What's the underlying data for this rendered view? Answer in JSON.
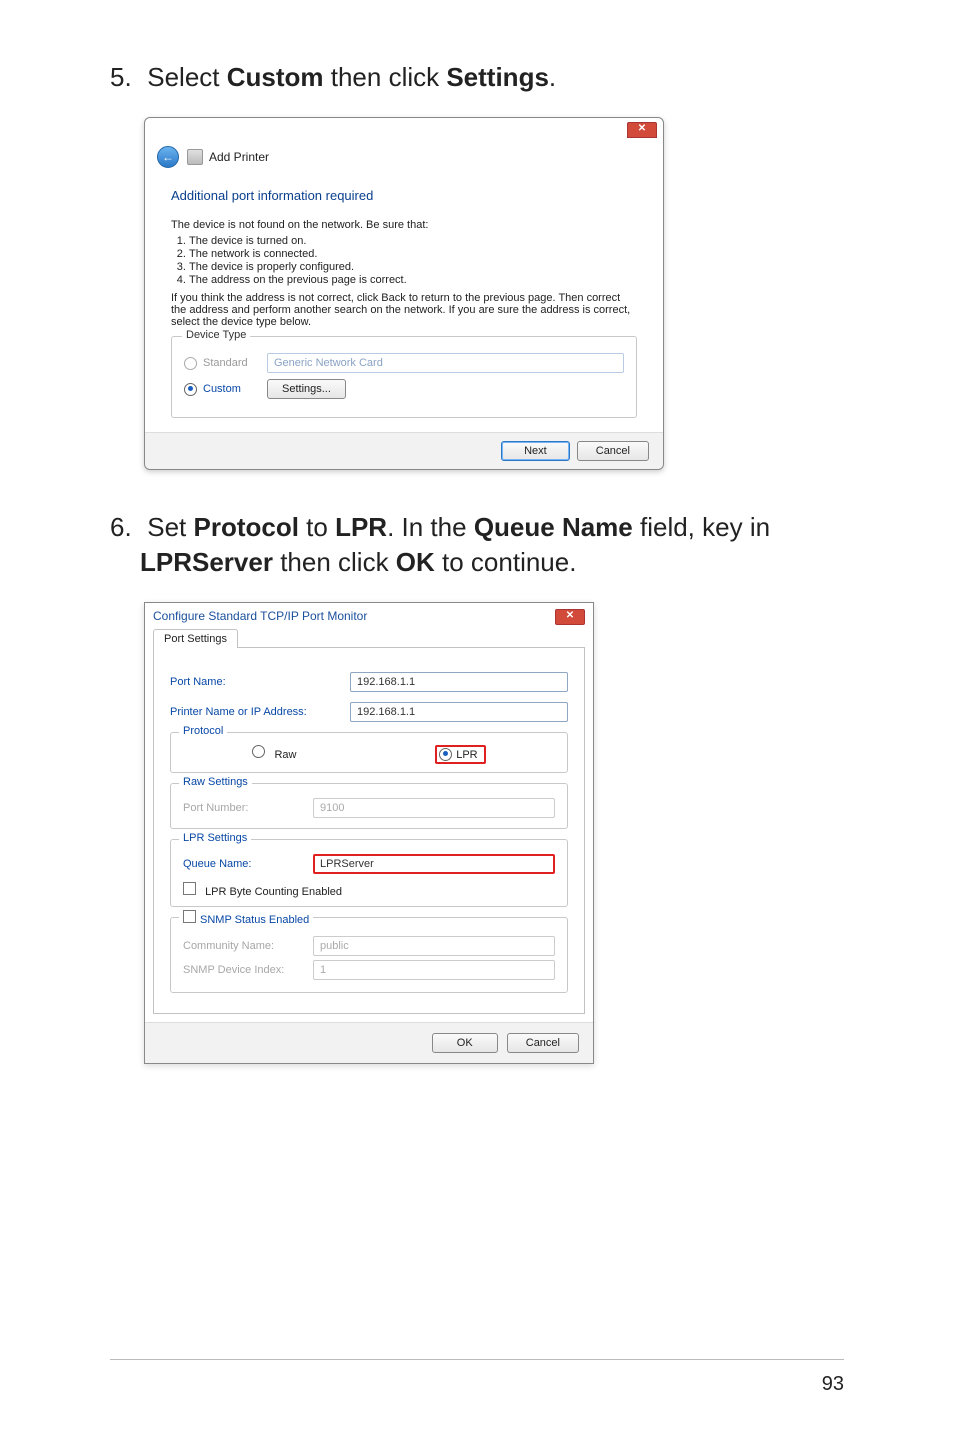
{
  "page_number": "93",
  "step5": {
    "number": "5.",
    "prefix": "Select ",
    "b1": "Custom",
    "mid": " then click ",
    "b2": "Settings",
    "suffix": "."
  },
  "step6": {
    "number": "6.",
    "prefix": "Set ",
    "b1": "Protocol",
    "mid1": " to ",
    "b2": "LPR",
    "mid2": ". In the ",
    "b3": "Queue Name",
    "mid3": " field, key in ",
    "b4": "LPRServer",
    "mid4": " then click ",
    "b5": "OK",
    "suffix": " to continue."
  },
  "dlg1": {
    "close": "✕",
    "back": "←",
    "title": "Add Printer",
    "subtitle": "Additional port information required",
    "intro": "The device is not found on the network.  Be sure that:",
    "items": [
      "The device is turned on.",
      "The network is connected.",
      "The device is properly configured.",
      "The address on the previous page is correct."
    ],
    "para": "If you think the address is not correct, click Back to return to the previous page.  Then correct the address and perform another search on the network.  If you are sure the address is correct, select the device type below.",
    "group_label": "Device Type",
    "standard_label": "Standard",
    "standard_value": "Generic Network Card",
    "custom_label": "Custom",
    "settings_btn": "Settings...",
    "next_btn": "Next",
    "cancel_btn": "Cancel"
  },
  "dlg2": {
    "title": "Configure Standard TCP/IP Port Monitor",
    "close": "✕",
    "tab": "Port Settings",
    "portname_label": "Port Name:",
    "portname_value": "192.168.1.1",
    "addr_label": "Printer Name or IP Address:",
    "addr_value": "192.168.1.1",
    "protocol_label": "Protocol",
    "raw_label": "Raw",
    "lpr_label": "LPR",
    "raw_settings_label": "Raw Settings",
    "portnum_label": "Port Number:",
    "portnum_value": "9100",
    "lpr_settings_label": "LPR Settings",
    "queue_label": "Queue Name:",
    "queue_value": "LPRServer",
    "lpr_byte_label": "LPR Byte Counting Enabled",
    "snmp_group_label": "SNMP Status Enabled",
    "community_label": "Community Name:",
    "community_value": "public",
    "devindex_label": "SNMP Device Index:",
    "devindex_value": "1",
    "ok_btn": "OK",
    "cancel_btn": "Cancel"
  }
}
